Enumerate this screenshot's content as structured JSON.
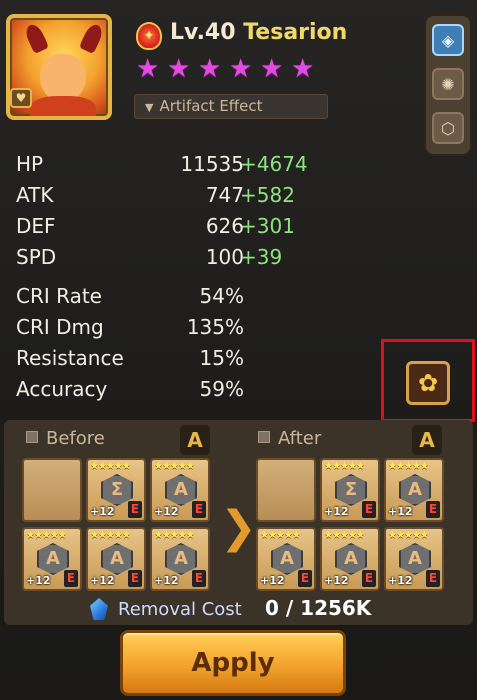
{
  "monster": {
    "level_label": "Lv.40",
    "name": "Tesarion",
    "stars": [
      "★",
      "★",
      "★",
      "★",
      "★",
      "★"
    ],
    "element_icon": "fire-element-icon",
    "artifact_button_label": "Artifact Effect"
  },
  "side_tabs": [
    {
      "icon": "monster-info-icon"
    },
    {
      "icon": "rune-icon"
    },
    {
      "icon": "artifact-icon"
    }
  ],
  "stats": [
    {
      "label": "HP",
      "value": "11535",
      "bonus": "+4674"
    },
    {
      "label": "ATK",
      "value": "747",
      "bonus": "+582"
    },
    {
      "label": "DEF",
      "value": "626",
      "bonus": "+301"
    },
    {
      "label": "SPD",
      "value": "100",
      "bonus": "+39"
    }
  ],
  "stats2": [
    {
      "label": "CRI Rate",
      "value": "54%"
    },
    {
      "label": "CRI Dmg",
      "value": "135%"
    },
    {
      "label": "Resistance",
      "value": "15%"
    },
    {
      "label": "Accuracy",
      "value": "59%"
    }
  ],
  "compare": {
    "before_label": "Before",
    "after_label": "After",
    "set_badge": "A",
    "before_slots": [
      {
        "empty": true
      },
      {
        "stars": "★★★★★",
        "rune": "Σ",
        "plus": "+12",
        "grade": "E"
      },
      {
        "stars": "★★★★★",
        "rune": "A",
        "plus": "+12",
        "grade": "E"
      },
      {
        "stars": "★★★★★",
        "rune": "A",
        "plus": "+12",
        "grade": "E"
      },
      {
        "stars": "★★★★★",
        "rune": "A",
        "plus": "+12",
        "grade": "E"
      },
      {
        "stars": "★★★★★",
        "rune": "A",
        "plus": "+12",
        "grade": "E"
      }
    ],
    "after_slots": [
      {
        "empty": true
      },
      {
        "stars": "★★★★★",
        "rune": "Σ",
        "plus": "+12",
        "grade": "E"
      },
      {
        "stars": "★★★★★",
        "rune": "A",
        "plus": "+12",
        "grade": "E"
      },
      {
        "stars": "★★★★★",
        "rune": "A",
        "plus": "+12",
        "grade": "E"
      },
      {
        "stars": "★★★★★",
        "rune": "A",
        "plus": "+12",
        "grade": "E"
      },
      {
        "stars": "★★★★★",
        "rune": "A",
        "plus": "+12",
        "grade": "E"
      }
    ],
    "arrow": "❯"
  },
  "cost": {
    "label": "Removal Cost",
    "value": "0 / 1256K"
  },
  "apply_label": "Apply"
}
